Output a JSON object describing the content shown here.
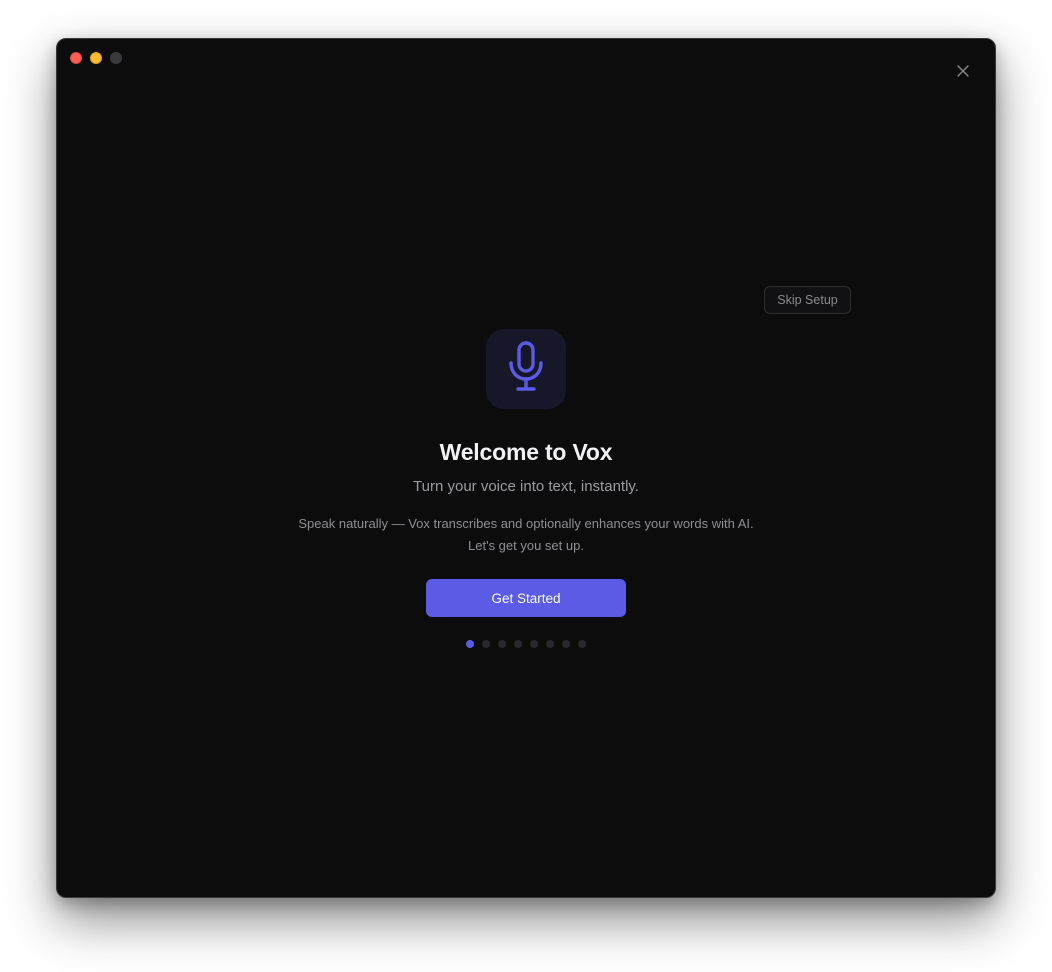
{
  "window": {
    "accent_color": "#5b5be6",
    "background_color": "#0c0c0d"
  },
  "skip_button": {
    "label": "Skip Setup"
  },
  "welcome": {
    "icon": "microphone-icon",
    "title": "Welcome to Vox",
    "subtitle": "Turn your voice into text, instantly.",
    "description": "Speak naturally — Vox transcribes and optionally enhances your words with AI. Let's get you set up.",
    "cta_label": "Get Started"
  },
  "pagination": {
    "total_steps": 8,
    "current_step": 1
  }
}
